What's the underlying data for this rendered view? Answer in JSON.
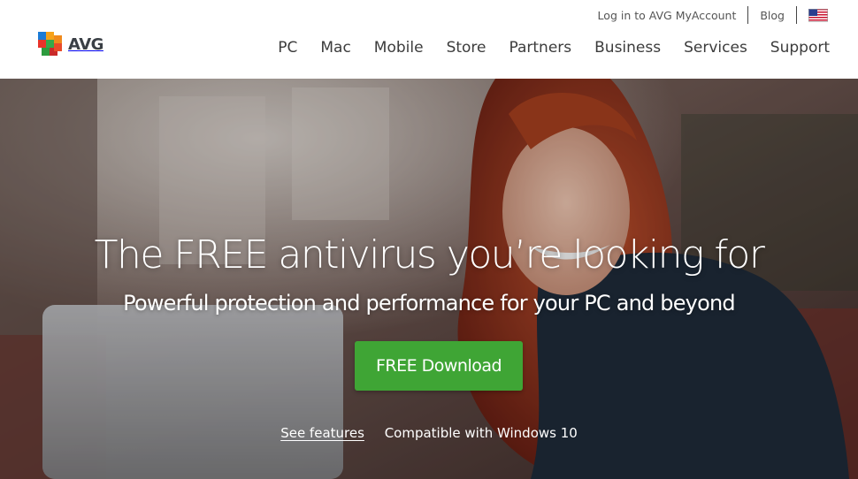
{
  "header": {
    "logo_text": "AVG",
    "utility_links": {
      "login": "Log in to AVG MyAccount",
      "blog": "Blog",
      "locale_flag_icon": "us-flag-icon"
    },
    "nav": [
      "PC",
      "Mac",
      "Mobile",
      "Store",
      "Partners",
      "Business",
      "Services",
      "Support"
    ]
  },
  "hero": {
    "headline": "The FREE antivirus you’re looking for",
    "subheadline": "Powerful protection and performance for your PC and beyond",
    "download_button": "FREE Download",
    "see_features": "See features",
    "compatibility": "Compatible with Windows 10"
  },
  "colors": {
    "download_button": "#3fa535",
    "header_bg": "#ffffff",
    "nav_text": "#3c3c3c"
  }
}
